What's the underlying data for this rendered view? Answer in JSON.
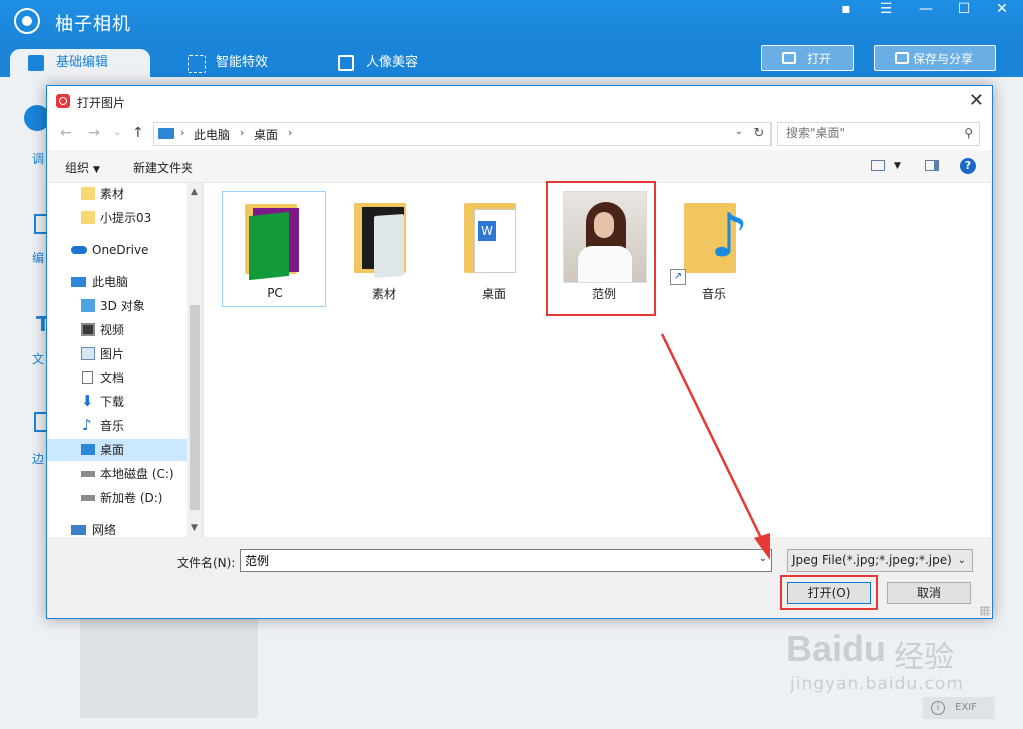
{
  "app": {
    "title": "柚子相机",
    "tabs": [
      {
        "label": "基础编辑"
      },
      {
        "label": "智能特效"
      },
      {
        "label": "人像美容"
      }
    ],
    "open_button": "打开",
    "save_share_button": "保存与分享",
    "sidebar": [
      {
        "label": "调"
      },
      {
        "label": "编"
      },
      {
        "label": "文"
      },
      {
        "label": "边"
      }
    ],
    "exif": "EXIF",
    "watermark": {
      "brand": "Baidu",
      "cn": "经验",
      "url": "jingyan.baidu.com"
    }
  },
  "dialog": {
    "title": "打开图片",
    "breadcrumb": [
      "此电脑",
      "桌面"
    ],
    "search_placeholder": "搜索\"桌面\"",
    "toolbar": {
      "organize": "组织",
      "new_folder": "新建文件夹"
    },
    "nav_items": [
      {
        "label": "素材",
        "icon": "folder-icon"
      },
      {
        "label": "小提示03",
        "icon": "folder-icon"
      },
      {
        "label": "OneDrive",
        "icon": "cloud-icon"
      },
      {
        "label": "此电脑",
        "icon": "computer-icon"
      },
      {
        "label": "3D 对象",
        "icon": "cube-icon"
      },
      {
        "label": "视频",
        "icon": "video-icon"
      },
      {
        "label": "图片",
        "icon": "pictures-icon"
      },
      {
        "label": "文档",
        "icon": "document-icon"
      },
      {
        "label": "下载",
        "icon": "download-icon"
      },
      {
        "label": "音乐",
        "icon": "music-icon"
      },
      {
        "label": "桌面",
        "icon": "desktop-icon",
        "selected": true
      },
      {
        "label": "本地磁盘 (C:)",
        "icon": "drive-icon"
      },
      {
        "label": "新加卷 (D:)",
        "icon": "drive-icon"
      },
      {
        "label": "网络",
        "icon": "network-icon"
      }
    ],
    "files": [
      {
        "name": "PC",
        "type": "folder"
      },
      {
        "name": "素材",
        "type": "folder"
      },
      {
        "name": "桌面",
        "type": "folder"
      },
      {
        "name": "范例",
        "type": "image"
      },
      {
        "name": "音乐",
        "type": "shortcut-folder"
      }
    ],
    "filename_label": "文件名(N):",
    "filename_value": "范例",
    "filetype": "Jpeg File(*.jpg;*.jpeg;*.jpe)",
    "open_button": "打开(O)",
    "cancel_button": "取消"
  },
  "colors": {
    "app_blue": "#1a84d8",
    "highlight_red": "#e53935",
    "selection": "#cce8ff"
  }
}
